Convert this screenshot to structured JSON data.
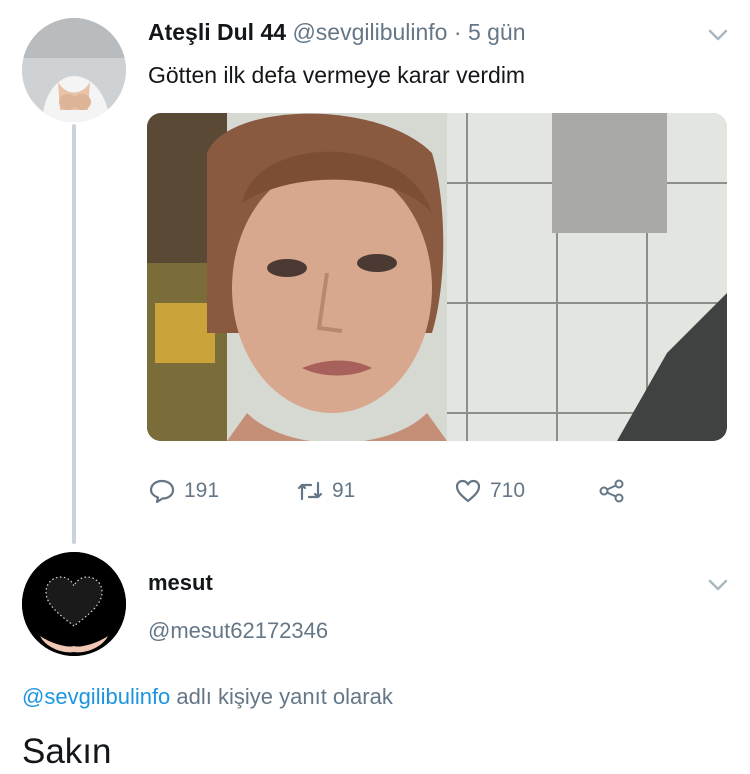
{
  "tweet": {
    "display_name": "Ateşli Dul 44",
    "handle": "@sevgilibulinfo",
    "separator": "·",
    "time_ago": "5 gün",
    "text": "Götten ilk defa vermeye karar verdim",
    "avatar_icon": "profile-photo-avatar",
    "photo_icon": "selfie-photo",
    "stats": {
      "replies": "191",
      "retweets": "91",
      "likes": "710"
    }
  },
  "reply": {
    "display_name": "mesut",
    "handle": "@mesut62172346",
    "avatar_icon": "heart-in-hands-avatar",
    "replying_to_handle": "@sevgilibulinfo",
    "replying_to_suffix": "adlı kişiye yanıt olarak",
    "text": "Sakın"
  },
  "colors": {
    "link": "#1b95e0",
    "muted": "#657786",
    "thread_line": "#c9d3dc"
  }
}
